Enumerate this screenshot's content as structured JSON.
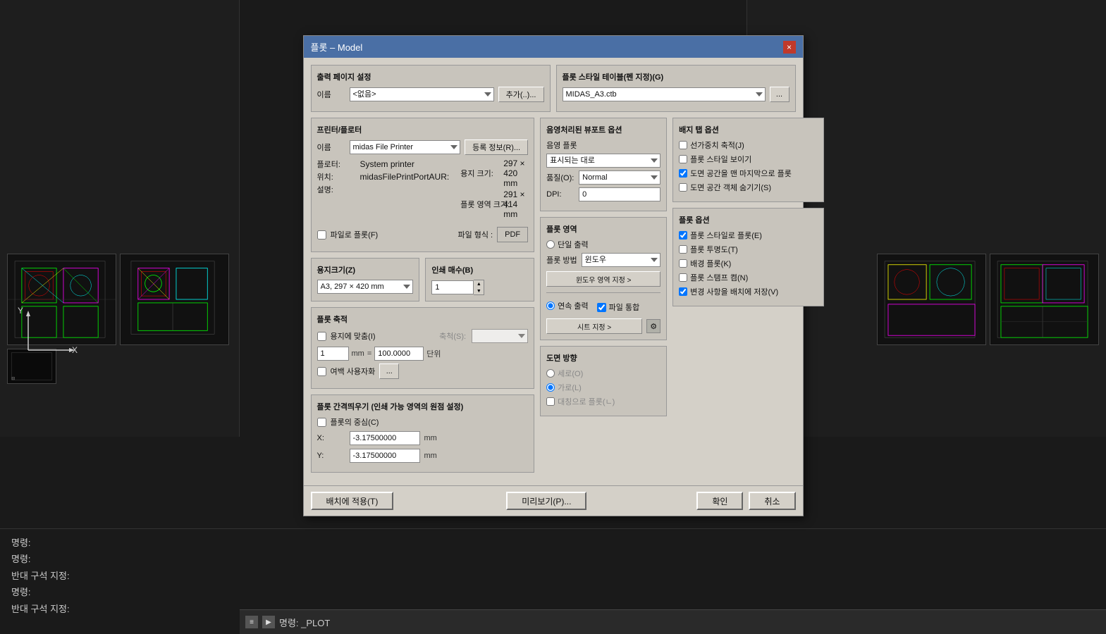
{
  "window": {
    "title": "플롯 – Model",
    "close_btn": "×"
  },
  "background": {
    "color": "#1a1a1a"
  },
  "command_lines": [
    "명령:",
    "명령:",
    "반대 구석 지정:",
    "명령:",
    "반대 구석 지정:"
  ],
  "command_prompt": {
    "icon": "≡",
    "prefix": "▶",
    "text": "명령:  _PLOT"
  },
  "dialog": {
    "page_setup_section": "출력 페이지 설정",
    "name_label": "이름",
    "name_value": "<없음>",
    "add_btn": "추가(..)...",
    "printer_section": "프린터/플로터",
    "printer_name_label": "이름",
    "printer_value": "midas File Printer",
    "reg_info_btn": "등록 정보(R)...",
    "plotter_label": "플로터:",
    "plotter_value": "System printer",
    "paper_size_label": "용지 크기:",
    "paper_size_value": "297 × 420 mm",
    "location_label": "위치:",
    "location_value": "midasFilePrintPortAUR:",
    "plot_area_label": "플롯 영역 크기:",
    "plot_area_value": "291 × 414 mm",
    "description_label": "설명:",
    "file_plot_label": "파일로 플롯(F)",
    "file_format_label": "파일 형식 :",
    "file_format_value": "PDF",
    "paper_size_section": "용지크기(Z)",
    "paper_size_combo": "A3, 297 × 420 mm",
    "print_scale_section": "인쇄 매수(B)",
    "print_scale_value": "1",
    "plot_axis_section": "플롯 축적",
    "fit_to_paper_label": "용지에 맞춤(I)",
    "axis_label": "축척(S):",
    "axis_value_1": "1",
    "axis_unit": "mm",
    "axis_equals": "=",
    "axis_value_2": "100.0000",
    "axis_unit2": "단위",
    "custom_scale_label": "여백 사용자화",
    "custom_dots_btn": "...",
    "plot_offset_section": "플롯 간격띄우기 (인쇄 가능 영역의 원점 설정)",
    "center_label": "플롯의 중심(C)",
    "x_label": "X:",
    "x_value": "-3.17500000",
    "x_unit": "mm",
    "y_label": "Y:",
    "y_value": "-3.17500000",
    "y_unit": "mm",
    "apply_btn": "배치에 적용(T)",
    "preview_btn": "미리보기(P)...",
    "plot_area_section": "플롯 영역",
    "single_output_label": "단일 출력",
    "plot_method_label": "플롯 방법",
    "plot_method_value": "윈도우",
    "window_set_btn": "윈도우 영역 지정 >",
    "continuous_label": "연속 출력",
    "file_merge_label": "파일 통합",
    "sheet_set_btn": "시트 지정 >",
    "direction_section": "도면 방향",
    "portrait_label": "세로(O)",
    "landscape_label": "가로(L)",
    "reverse_label": "대칭으로 플롯(ㄴ)",
    "style_table_section": "플롯 스타일 테이블(펜 지정)(G)",
    "style_table_value": "MIDAS_A3.ctb",
    "style_table_dots": "...",
    "shaded_section": "음영처리된 뷰포트 옵션",
    "shade_plot_label": "음영 플롯",
    "shade_plot_value": "표시되는 대로",
    "quality_label": "품질(O):",
    "quality_value": "Normal",
    "dpi_label": "DPI:",
    "dpi_value": "0",
    "layout_tab_section": "배지 탭 옵션",
    "layout_opt1": "선가중치 축적(J)",
    "layout_opt1_checked": false,
    "layout_opt2": "플롯 스타일 보이기",
    "layout_opt2_checked": false,
    "layout_opt3": "도면 공간을 맨 마지막으로 플롯",
    "layout_opt3_checked": true,
    "layout_opt4": "도면 공간 객체 숨기기(S)",
    "layout_opt4_checked": false,
    "plot_options_section": "플롯 옵션",
    "plot_opt1": "플롯 스타일로 플롯(E)",
    "plot_opt1_checked": true,
    "plot_opt2": "플롯 투명도(T)",
    "plot_opt2_checked": false,
    "plot_opt3": "배경 플롯(K)",
    "plot_opt3_checked": false,
    "plot_opt4": "플롯 스탬프 켬(N)",
    "plot_opt4_checked": false,
    "plot_opt5": "변경 사항을 배치에 저장(V)",
    "plot_opt5_checked": true,
    "ok_btn": "확인",
    "cancel_btn": "취소"
  },
  "axis": {
    "y_label": "Y",
    "x_label": "X"
  }
}
